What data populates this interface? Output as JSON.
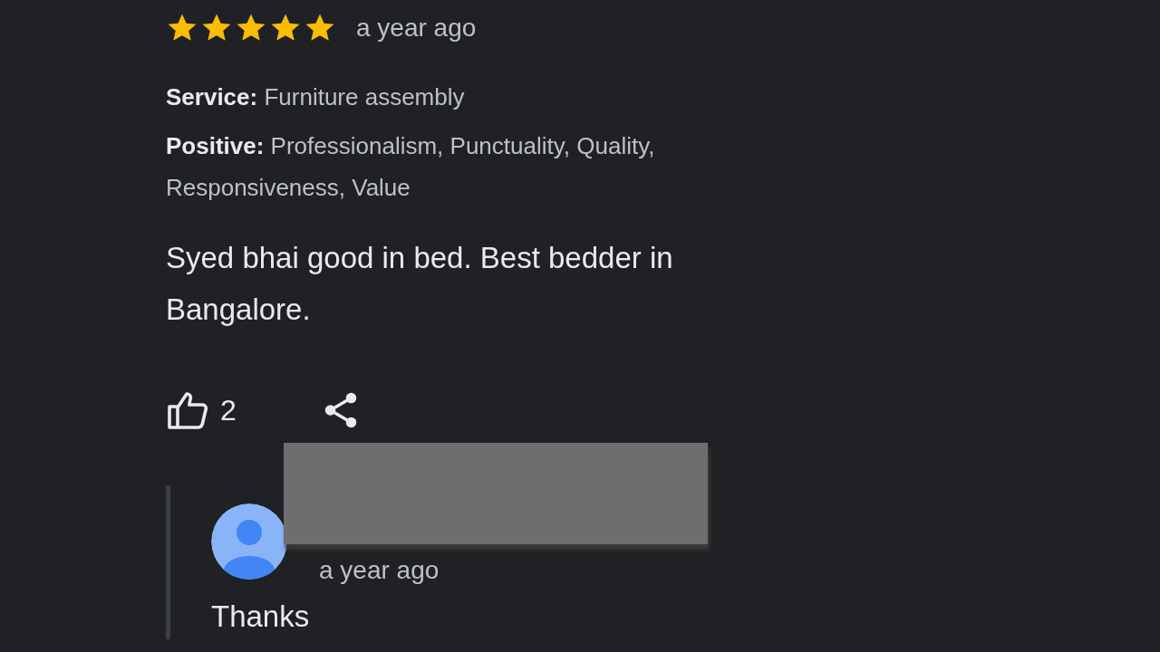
{
  "review": {
    "stars": 5,
    "time": "a year ago",
    "service_label": "Service:",
    "service": "Furniture assembly",
    "positive_label": "Positive:",
    "positive": "Professionalism, Punctuality, Quality, Responsiveness, Value",
    "text": "Syed bhai good in bed. Best bedder in Bangalore.",
    "likes": "2"
  },
  "reply": {
    "time": "a year ago",
    "text": "Thanks"
  }
}
